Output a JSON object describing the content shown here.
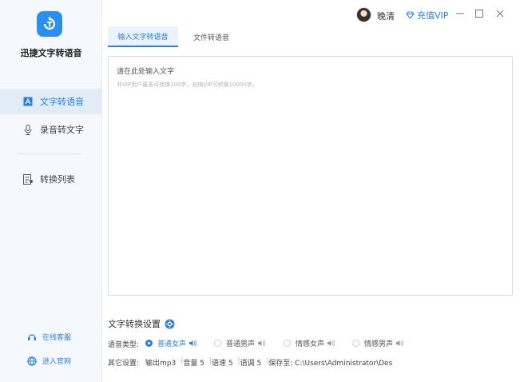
{
  "app": {
    "name": "迅捷文字转语音"
  },
  "sidebar": {
    "items": [
      {
        "label": "文字转语音",
        "icon": "text-to-speech-icon"
      },
      {
        "label": "录音转文字",
        "icon": "microphone-icon"
      },
      {
        "label": "转换列表",
        "icon": "list-icon"
      }
    ],
    "bottom": [
      {
        "label": "在线客服",
        "icon": "customer-service-icon"
      },
      {
        "label": "进入官网",
        "icon": "globe-icon"
      }
    ]
  },
  "header": {
    "user_name": "晚清",
    "vip_label": "充值VIP"
  },
  "tabs": [
    {
      "label": "输入文字转语音"
    },
    {
      "label": "文件转语音"
    }
  ],
  "editor": {
    "placeholder": "请在此处输入文字",
    "hint": "非VIP用户最多可转换100字，充值VIP可转换10000字。"
  },
  "settings": {
    "title": "文字转换设置",
    "voice_type_label": "语音类型:",
    "voices": [
      "普通女声",
      "普通男声",
      "情感女声",
      "情感男声"
    ],
    "selected_voice": "普通女声",
    "other_label": "其它设置:",
    "output": "输出mp3",
    "volume": "音量 5",
    "speed": "语速 5",
    "pitch": "语调 5",
    "save_to": "保存至: C:\\Users\\Administrator\\Des"
  },
  "colors": {
    "accent": "#2b7fd9",
    "sidebar_bg": "#f5f8fc",
    "active_bg": "#e2ecf7"
  }
}
